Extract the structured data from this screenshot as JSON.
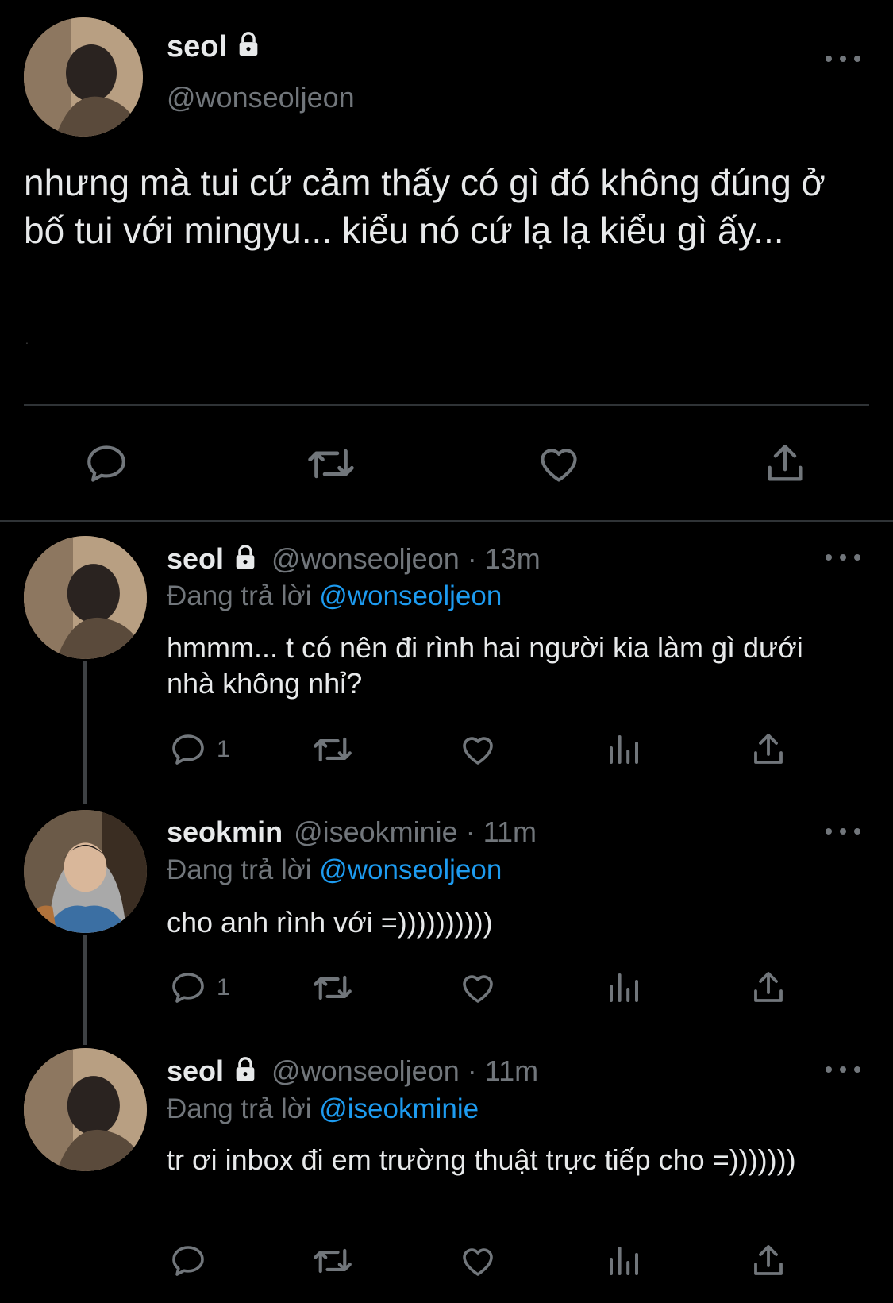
{
  "main_tweet": {
    "author_name": "seol",
    "author_handle": "@wonseoljeon",
    "text": "nhưng mà tui cứ cảm thấy có gì đó không đúng ở bố tui với mingyu... kiểu nó cứ lạ lạ kiểu gì ấy...",
    "dot": "."
  },
  "replies": [
    {
      "author_name": "seol",
      "handle_time": "@wonseoljeon · 13m",
      "replying_prefix": "Đang trả lời",
      "replying_to": "@wonseoljeon",
      "text": "hmmm... t có nên đi rình hai người kia làm gì dưới nhà không nhỉ?",
      "reply_count": "1",
      "locked": true
    },
    {
      "author_name": "seokmin",
      "handle_time": "@iseokminie · 11m",
      "replying_prefix": "Đang trả lời",
      "replying_to": "@wonseoljeon",
      "text": "cho anh rình với =))))))))))",
      "reply_count": "1",
      "locked": false
    },
    {
      "author_name": "seol",
      "handle_time": "@wonseoljeon · 11m",
      "replying_prefix": "Đang trả lời",
      "replying_to": "@iseokminie",
      "text": "tr ơi inbox đi em trường thuật trực tiếp cho =)))))))",
      "reply_count": "",
      "locked": true
    }
  ],
  "colors": {
    "background": "#000000",
    "text": "#e7e9ea",
    "secondary": "#71767b",
    "link": "#1d9bf0",
    "divider": "#2f3336"
  },
  "icons": [
    "lock-icon",
    "more-icon",
    "reply-icon",
    "retweet-icon",
    "like-icon",
    "share-icon",
    "views-icon"
  ]
}
